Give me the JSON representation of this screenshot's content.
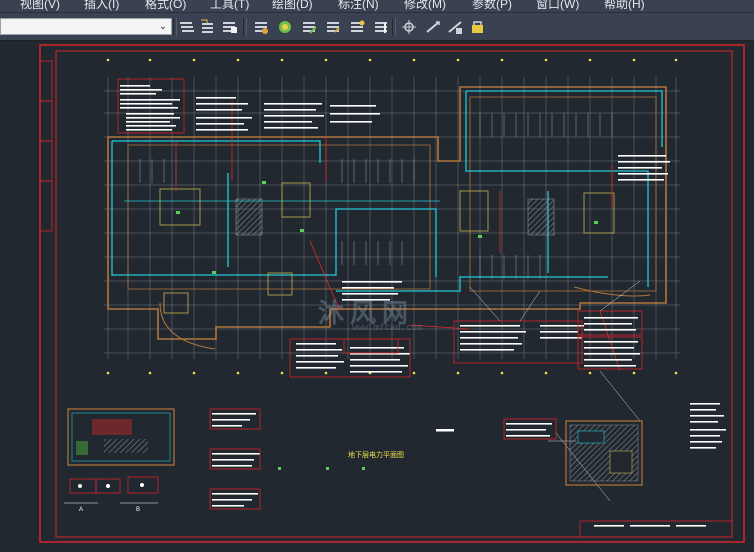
{
  "menu": {
    "items": [
      "视图(V)",
      "插入(I)",
      "格式(O)",
      "工具(T)",
      "绘图(D)",
      "标注(N)",
      "修改(M)",
      "参数(P)",
      "窗口(W)",
      "帮助(H)"
    ]
  },
  "toolbar": {
    "combo_value": "",
    "group1_icons": [
      "layer-properties-icon",
      "layer-state-icon",
      "layer-previous-icon"
    ],
    "group2_icons": [
      "layer-isolate-icon",
      "layer-off-icon",
      "layer-freeze-icon",
      "layer-lock-icon",
      "layer-match-icon",
      "layer-walk-icon",
      "layer-merge-icon"
    ],
    "group3_icons": [
      "dimension-icon",
      "text-style-icon",
      "table-style-icon",
      "multileader-icon"
    ]
  },
  "drawing": {
    "watermark": "沐风网",
    "watermark_sub": "www.mfcad.com",
    "plan_title": "地下层电力平面图",
    "colors": {
      "background": "#212830",
      "frame": "#d8232a",
      "wall": "#b3763a",
      "cable": "#23c8d6",
      "grid": "#8a8f99",
      "text": "#ffffff",
      "highlight": "#f2e24a"
    }
  }
}
